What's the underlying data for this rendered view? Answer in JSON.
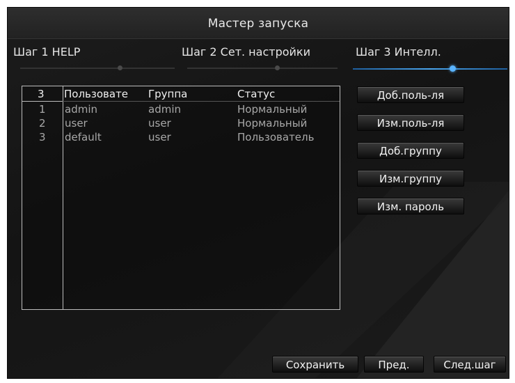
{
  "window": {
    "title": "Мастер запуска"
  },
  "steps": [
    {
      "label": "Шаг 1 HELP",
      "active": false
    },
    {
      "label": "Шаг 2 Сет. настройки",
      "active": false
    },
    {
      "label": "Шаг 3 Интелл.",
      "active": true
    }
  ],
  "table": {
    "count": "3",
    "columns": [
      "Пользовате",
      "Группа",
      "Статус"
    ],
    "rows": [
      {
        "num": "1",
        "user": "admin",
        "group": "admin",
        "status": "Нормальный"
      },
      {
        "num": "2",
        "user": "user",
        "group": "user",
        "status": "Нормальный"
      },
      {
        "num": "3",
        "user": "default",
        "group": "user",
        "status": "Пользователь"
      }
    ]
  },
  "side_buttons": {
    "add_user": "Доб.поль-ля",
    "edit_user": "Изм.поль-ля",
    "add_group": "Доб.группу",
    "edit_group": "Изм.группу",
    "change_password": "Изм. пароль"
  },
  "bottom_buttons": {
    "save": "Сохранить",
    "prev": "Пред.",
    "next": "След.шаг"
  },
  "colors": {
    "accent": "#4aa6ee",
    "background": "#181818",
    "text": "#e6e6e6",
    "muted": "#a8a8a8"
  }
}
